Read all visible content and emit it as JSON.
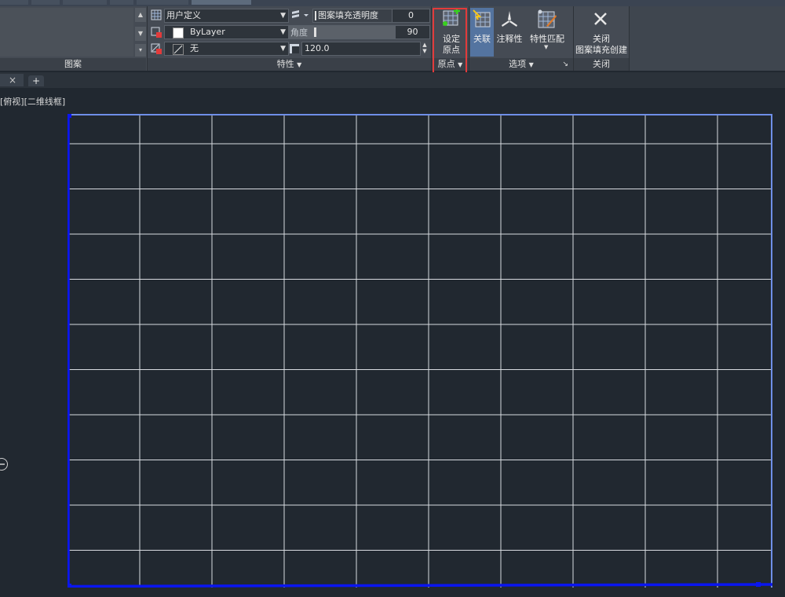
{
  "ribbon": {
    "panels": {
      "pattern": "图案",
      "properties": "特性",
      "origin": "原点",
      "options": "选项",
      "close": "关闭"
    },
    "properties": {
      "hatch_type": "用户定义",
      "transparency_label": "图案填充透明度",
      "transparency_value": "0",
      "color": "ByLayer",
      "angle_label": "角度",
      "angle_value": "90",
      "background": "无",
      "spacing_value": "120.0"
    },
    "buttons": {
      "set_origin_line1": "设定",
      "set_origin_line2": "原点",
      "associative": "关联",
      "annotative": "注释性",
      "match_properties": "特性匹配",
      "close_line1": "关闭",
      "close_line2": "图案填充创建"
    },
    "highlight_color": "#e23b3b"
  },
  "tabs": {
    "file_close": "×",
    "add": "+"
  },
  "viewport": {
    "label": "[俯视][二维线框]",
    "grid": {
      "columns": 10,
      "rows": 11,
      "line_color": "#d8dbe0",
      "boundary_color": "#0a16f0",
      "top_edge_color": "#6f8fe8"
    }
  }
}
